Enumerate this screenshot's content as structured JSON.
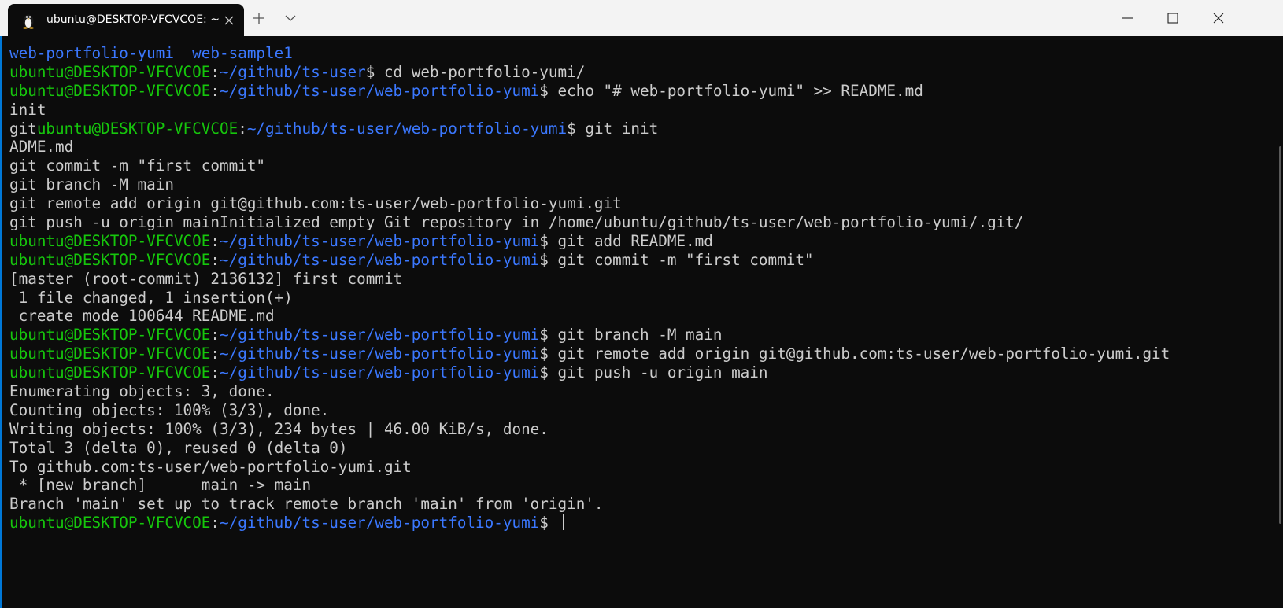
{
  "window": {
    "tab_title": "ubuntu@DESKTOP-VFCVCOE: ~"
  },
  "icons": {
    "tab": "linux-penguin-icon",
    "close_tab": "close-icon",
    "new_tab": "plus-icon",
    "dropdown": "chevron-down-icon",
    "minimize": "minimize-icon",
    "maximize": "maximize-icon",
    "close_window": "close-icon"
  },
  "colors": {
    "background": "#0c0c0c",
    "text": "#cccccc",
    "user_host": "#16c60c",
    "path": "#3b78ff",
    "titlebar": "#f3f3f3"
  },
  "terminal": {
    "prompt_user": "ubuntu@DESKTOP-VFCVCOE",
    "lines": [
      {
        "segments": [
          {
            "t": "web-portfolio-yumi  web-sample1",
            "c": "dir"
          }
        ]
      },
      {
        "segments": [
          {
            "t": "ubuntu@DESKTOP-VFCVCOE",
            "c": "user"
          },
          {
            "t": ":",
            "c": "text"
          },
          {
            "t": "~/github/ts-user",
            "c": "path"
          },
          {
            "t": "$ cd web-portfolio-yumi/",
            "c": "text"
          }
        ]
      },
      {
        "segments": [
          {
            "t": "ubuntu@DESKTOP-VFCVCOE",
            "c": "user"
          },
          {
            "t": ":",
            "c": "text"
          },
          {
            "t": "~/github/ts-user/web-portfolio-yumi",
            "c": "path"
          },
          {
            "t": "$ echo \"# web-portfolio-yumi\" >> README.md",
            "c": "text"
          }
        ]
      },
      {
        "segments": [
          {
            "t": "init",
            "c": "text"
          }
        ]
      },
      {
        "segments": [
          {
            "t": "git",
            "c": "text"
          },
          {
            "t": "ubuntu@DESKTOP-VFCVCOE",
            "c": "user"
          },
          {
            "t": ":",
            "c": "text"
          },
          {
            "t": "~/github/ts-user/web-portfolio-yumi",
            "c": "path"
          },
          {
            "t": "$ git init",
            "c": "text"
          }
        ]
      },
      {
        "segments": [
          {
            "t": "ADME.md",
            "c": "text"
          }
        ]
      },
      {
        "segments": [
          {
            "t": "git commit -m \"first commit\"",
            "c": "text"
          }
        ]
      },
      {
        "segments": [
          {
            "t": "git branch -M main",
            "c": "text"
          }
        ]
      },
      {
        "segments": [
          {
            "t": "git remote add origin git@github.com:ts-user/web-portfolio-yumi.git",
            "c": "text"
          }
        ]
      },
      {
        "segments": [
          {
            "t": "git push -u origin mainInitialized empty Git repository in /home/ubuntu/github/ts-user/web-portfolio-yumi/.git/",
            "c": "text"
          }
        ]
      },
      {
        "segments": [
          {
            "t": "ubuntu@DESKTOP-VFCVCOE",
            "c": "user"
          },
          {
            "t": ":",
            "c": "text"
          },
          {
            "t": "~/github/ts-user/web-portfolio-yumi",
            "c": "path"
          },
          {
            "t": "$ git add README.md",
            "c": "text"
          }
        ]
      },
      {
        "segments": [
          {
            "t": "ubuntu@DESKTOP-VFCVCOE",
            "c": "user"
          },
          {
            "t": ":",
            "c": "text"
          },
          {
            "t": "~/github/ts-user/web-portfolio-yumi",
            "c": "path"
          },
          {
            "t": "$ git commit -m \"first commit\"",
            "c": "text"
          }
        ]
      },
      {
        "segments": [
          {
            "t": "[master (root-commit) 2136132] first commit",
            "c": "text"
          }
        ]
      },
      {
        "segments": [
          {
            "t": " 1 file changed, 1 insertion(+)",
            "c": "text"
          }
        ]
      },
      {
        "segments": [
          {
            "t": " create mode 100644 README.md",
            "c": "text"
          }
        ]
      },
      {
        "segments": [
          {
            "t": "ubuntu@DESKTOP-VFCVCOE",
            "c": "user"
          },
          {
            "t": ":",
            "c": "text"
          },
          {
            "t": "~/github/ts-user/web-portfolio-yumi",
            "c": "path"
          },
          {
            "t": "$ git branch -M main",
            "c": "text"
          }
        ]
      },
      {
        "segments": [
          {
            "t": "ubuntu@DESKTOP-VFCVCOE",
            "c": "user"
          },
          {
            "t": ":",
            "c": "text"
          },
          {
            "t": "~/github/ts-user/web-portfolio-yumi",
            "c": "path"
          },
          {
            "t": "$ git remote add origin git@github.com:ts-user/web-portfolio-yumi.git",
            "c": "text"
          }
        ]
      },
      {
        "segments": [
          {
            "t": "ubuntu@DESKTOP-VFCVCOE",
            "c": "user"
          },
          {
            "t": ":",
            "c": "text"
          },
          {
            "t": "~/github/ts-user/web-portfolio-yumi",
            "c": "path"
          },
          {
            "t": "$ git push -u origin main",
            "c": "text"
          }
        ]
      },
      {
        "segments": [
          {
            "t": "Enumerating objects: 3, done.",
            "c": "text"
          }
        ]
      },
      {
        "segments": [
          {
            "t": "Counting objects: 100% (3/3), done.",
            "c": "text"
          }
        ]
      },
      {
        "segments": [
          {
            "t": "Writing objects: 100% (3/3), 234 bytes | 46.00 KiB/s, done.",
            "c": "text"
          }
        ]
      },
      {
        "segments": [
          {
            "t": "Total 3 (delta 0), reused 0 (delta 0)",
            "c": "text"
          }
        ]
      },
      {
        "segments": [
          {
            "t": "To github.com:ts-user/web-portfolio-yumi.git",
            "c": "text"
          }
        ]
      },
      {
        "segments": [
          {
            "t": " * [new branch]      main -> main",
            "c": "text"
          }
        ]
      },
      {
        "segments": [
          {
            "t": "Branch 'main' set up to track remote branch 'main' from 'origin'.",
            "c": "text"
          }
        ]
      },
      {
        "segments": [
          {
            "t": "ubuntu@DESKTOP-VFCVCOE",
            "c": "user"
          },
          {
            "t": ":",
            "c": "text"
          },
          {
            "t": "~/github/ts-user/web-portfolio-yumi",
            "c": "path"
          },
          {
            "t": "$ ",
            "c": "text"
          }
        ],
        "cursor": true
      }
    ]
  }
}
